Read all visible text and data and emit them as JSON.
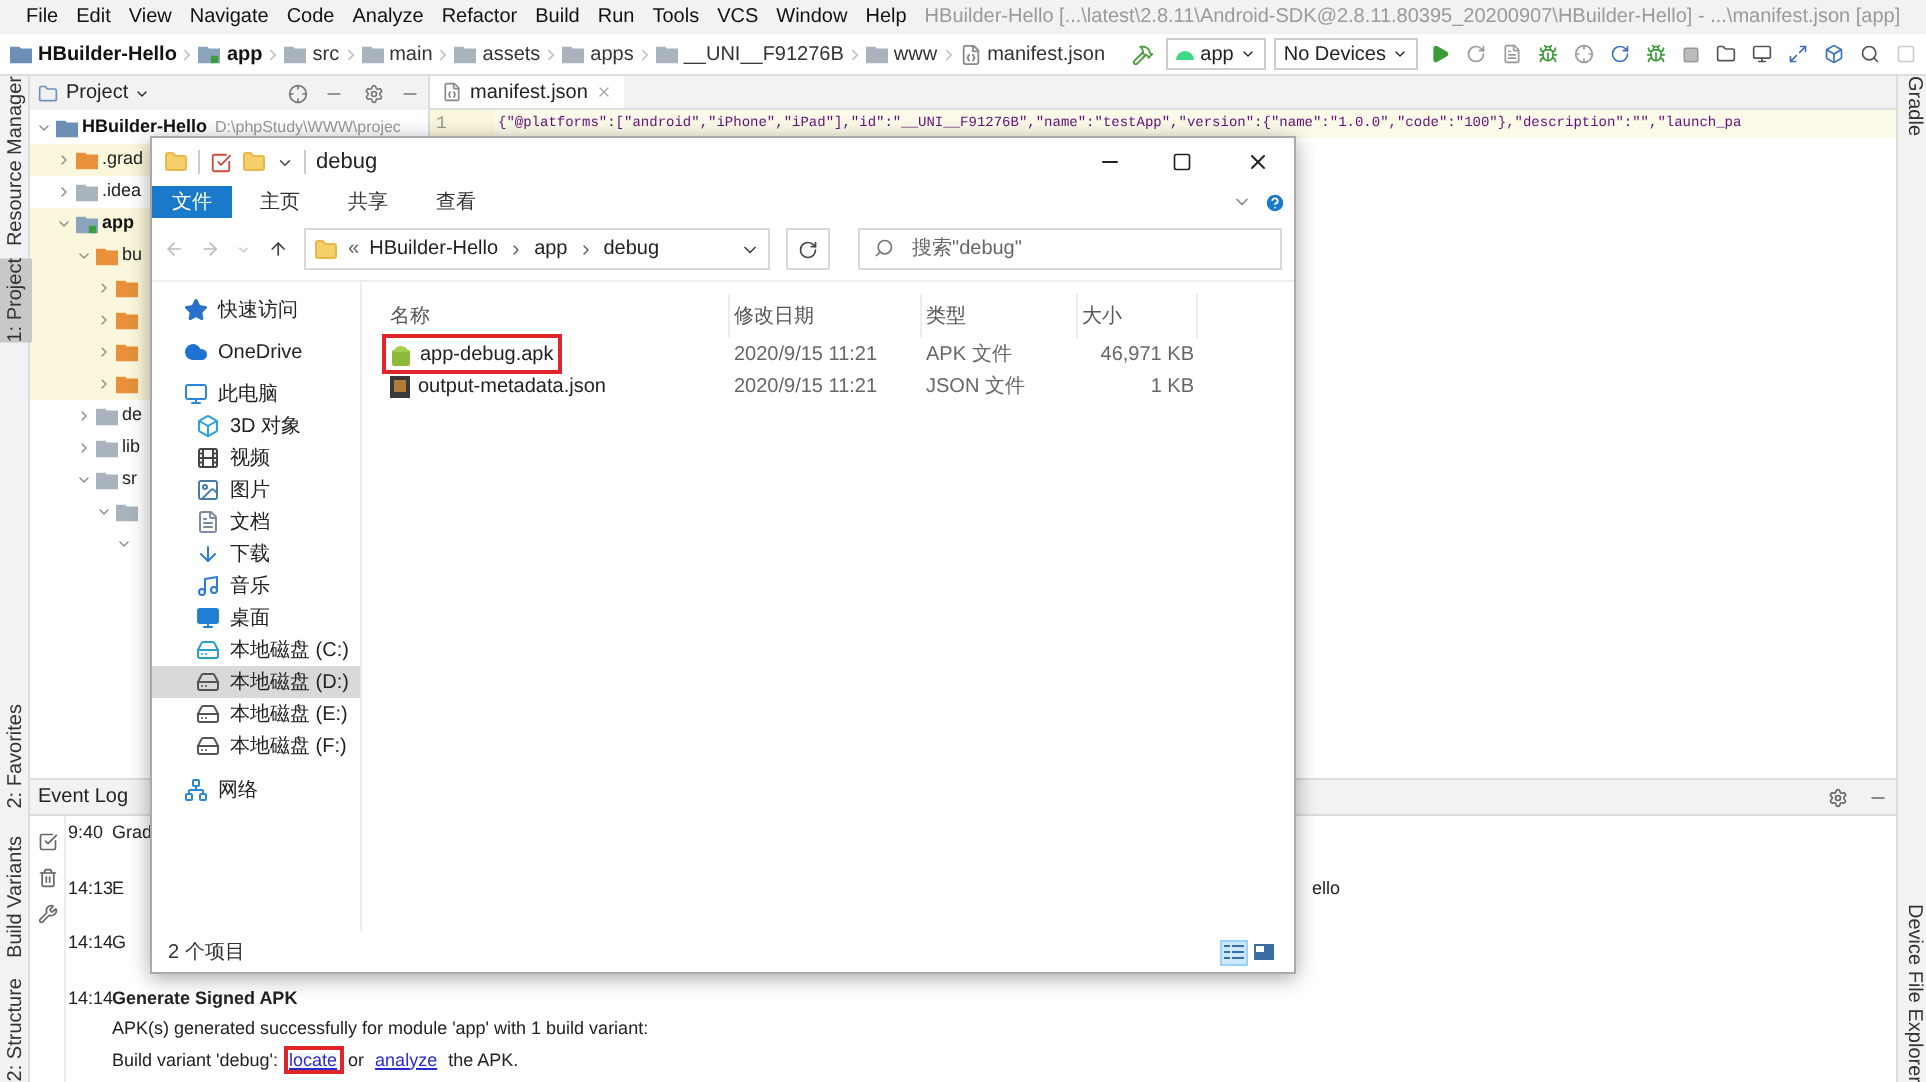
{
  "window": {
    "title": "HBuilder-Hello [...\\latest\\2.8.11\\Android-SDK@2.8.11.80395_20200907\\HBuilder-Hello] - ...\\manifest.json [app]"
  },
  "menu": [
    "File",
    "Edit",
    "View",
    "Navigate",
    "Code",
    "Analyze",
    "Refactor",
    "Build",
    "Run",
    "Tools",
    "VCS",
    "Window",
    "Help"
  ],
  "breadcrumb": [
    {
      "label": "HBuilder-Hello",
      "kind": "project"
    },
    {
      "label": "app",
      "kind": "module"
    },
    {
      "label": "src",
      "kind": "folder"
    },
    {
      "label": "main",
      "kind": "folder"
    },
    {
      "label": "assets",
      "kind": "resource"
    },
    {
      "label": "apps",
      "kind": "folder"
    },
    {
      "label": "__UNI__F91276B",
      "kind": "folder"
    },
    {
      "label": "www",
      "kind": "folder"
    },
    {
      "label": "manifest.json",
      "kind": "file"
    }
  ],
  "run_config": {
    "module": "app",
    "device": "No Devices"
  },
  "left_tool_windows": [
    {
      "label": "Resource Manager",
      "selected": false
    },
    {
      "label": "1: Project",
      "selected": true
    },
    {
      "label": "2: Favorites",
      "selected": false
    },
    {
      "label": "Build Variants",
      "selected": false
    },
    {
      "label": "2: Structure",
      "selected": false
    }
  ],
  "right_tool_windows": [
    {
      "label": "Gradle"
    },
    {
      "label": "Device File Explorer"
    }
  ],
  "project_panel": {
    "title": "Project",
    "tree": [
      {
        "label": "HBuilder-Hello",
        "path": "D:\\phpStudy\\WWW\\projec",
        "kind": "project",
        "expanded": true,
        "highlighted": false,
        "children": [
          {
            "label": ".grad",
            "kind": "orange",
            "expanded": false,
            "highlighted": true
          },
          {
            "label": ".idea",
            "kind": "folder",
            "expanded": false,
            "highlighted": false
          },
          {
            "label": "app",
            "kind": "module",
            "expanded": true,
            "highlighted": true,
            "children": [
              {
                "label": "bu",
                "kind": "orange",
                "expanded": true,
                "highlighted": true,
                "children": [
                  {
                    "kind": "orange",
                    "expanded": false,
                    "highlighted": true
                  },
                  {
                    "kind": "orange",
                    "expanded": false,
                    "highlighted": true
                  },
                  {
                    "kind": "orange",
                    "expanded": false,
                    "highlighted": true
                  },
                  {
                    "kind": "orange",
                    "expanded": false,
                    "highlighted": true
                  }
                ]
              },
              {
                "label": "de",
                "kind": "folder",
                "expanded": false,
                "highlighted": false
              },
              {
                "label": "lib",
                "kind": "folder",
                "expanded": false,
                "highlighted": false
              },
              {
                "label": "sr",
                "kind": "folder",
                "expanded": true,
                "highlighted": false,
                "children": [
                  {
                    "kind": "folder",
                    "expanded": true,
                    "highlighted": false,
                    "children": [
                      {
                        "expanded": true,
                        "highlighted": false
                      }
                    ]
                  }
                ]
              }
            ]
          }
        ]
      }
    ]
  },
  "editor": {
    "tabs": [
      {
        "label": "manifest.json",
        "selected": true
      }
    ],
    "lines": [
      {
        "number": "1",
        "text": "{\"@platforms\":[\"android\",\"iPhone\",\"iPad\"],\"id\":\"__UNI__F91276B\",\"name\":\"testApp\",\"version\":{\"name\":\"1.0.0\",\"code\":\"100\"},\"description\":\"\",\"launch_pa"
      }
    ]
  },
  "event_log": {
    "title": "Event Log",
    "entries": [
      {
        "time": "9:40",
        "text": "Grad"
      },
      {
        "time": "14:13",
        "text": "E",
        "tail": "ello"
      },
      {
        "time": "14:14",
        "text": "G"
      },
      {
        "time": "14:14",
        "title": "Generate Signed APK",
        "lines": [
          [
            {
              "kind": "text",
              "text": "APK(s) generated successfully for module 'app' with 1 build variant:"
            }
          ],
          [
            {
              "kind": "text",
              "text": "Build variant 'debug': "
            },
            {
              "kind": "link",
              "text": "locate",
              "highlighted": true
            },
            {
              "kind": "text",
              "text": " or "
            },
            {
              "kind": "link",
              "text": "analyze",
              "highlighted": false
            },
            {
              "kind": "text",
              "text": " the APK."
            }
          ]
        ]
      }
    ]
  },
  "explorer": {
    "title": "debug",
    "ribbon_tabs": [
      {
        "label": "文件",
        "selected": true
      },
      {
        "label": "主页",
        "selected": false
      },
      {
        "label": "共享",
        "selected": false
      },
      {
        "label": "查看",
        "selected": false
      }
    ],
    "address": [
      "«",
      "HBuilder-Hello",
      "app",
      "debug"
    ],
    "search": {
      "placeholder": "搜索\"debug\""
    },
    "nav": [
      {
        "label": "快速访问",
        "kind": "star",
        "selected": false
      },
      {
        "label": "OneDrive",
        "kind": "cloud",
        "selected": false
      },
      {
        "label": "此电脑",
        "kind": "pc",
        "selected": false,
        "children": [
          {
            "label": "3D 对象",
            "kind": "cube",
            "selected": false
          },
          {
            "label": "视频",
            "kind": "video",
            "selected": false
          },
          {
            "label": "图片",
            "kind": "image",
            "selected": false
          },
          {
            "label": "文档",
            "kind": "doc",
            "selected": false
          },
          {
            "label": "下载",
            "kind": "download",
            "selected": false
          },
          {
            "label": "音乐",
            "kind": "music",
            "selected": false
          },
          {
            "label": "桌面",
            "kind": "desktop",
            "selected": false
          },
          {
            "label": "本地磁盘 (C:)",
            "kind": "sysdrive",
            "selected": false
          },
          {
            "label": "本地磁盘 (D:)",
            "kind": "drive",
            "selected": true
          },
          {
            "label": "本地磁盘 (E:)",
            "kind": "drive",
            "selected": false
          },
          {
            "label": "本地磁盘 (F:)",
            "kind": "drive",
            "selected": false
          }
        ]
      },
      {
        "label": "网络",
        "kind": "network",
        "selected": false
      }
    ],
    "columns": [
      "名称",
      "修改日期",
      "类型",
      "大小"
    ],
    "files": [
      {
        "name": "app-debug.apk",
        "kind": "apk",
        "date": "2020/9/15 11:21",
        "type": "APK 文件",
        "size": "46,971 KB",
        "highlighted": true
      },
      {
        "name": "output-metadata.json",
        "kind": "json",
        "date": "2020/9/15 11:21",
        "type": "JSON 文件",
        "size": "1 KB",
        "highlighted": false
      }
    ],
    "status": "2 个项目",
    "views": [
      {
        "kind": "details",
        "selected": true
      },
      {
        "kind": "tiles",
        "selected": false
      }
    ]
  }
}
